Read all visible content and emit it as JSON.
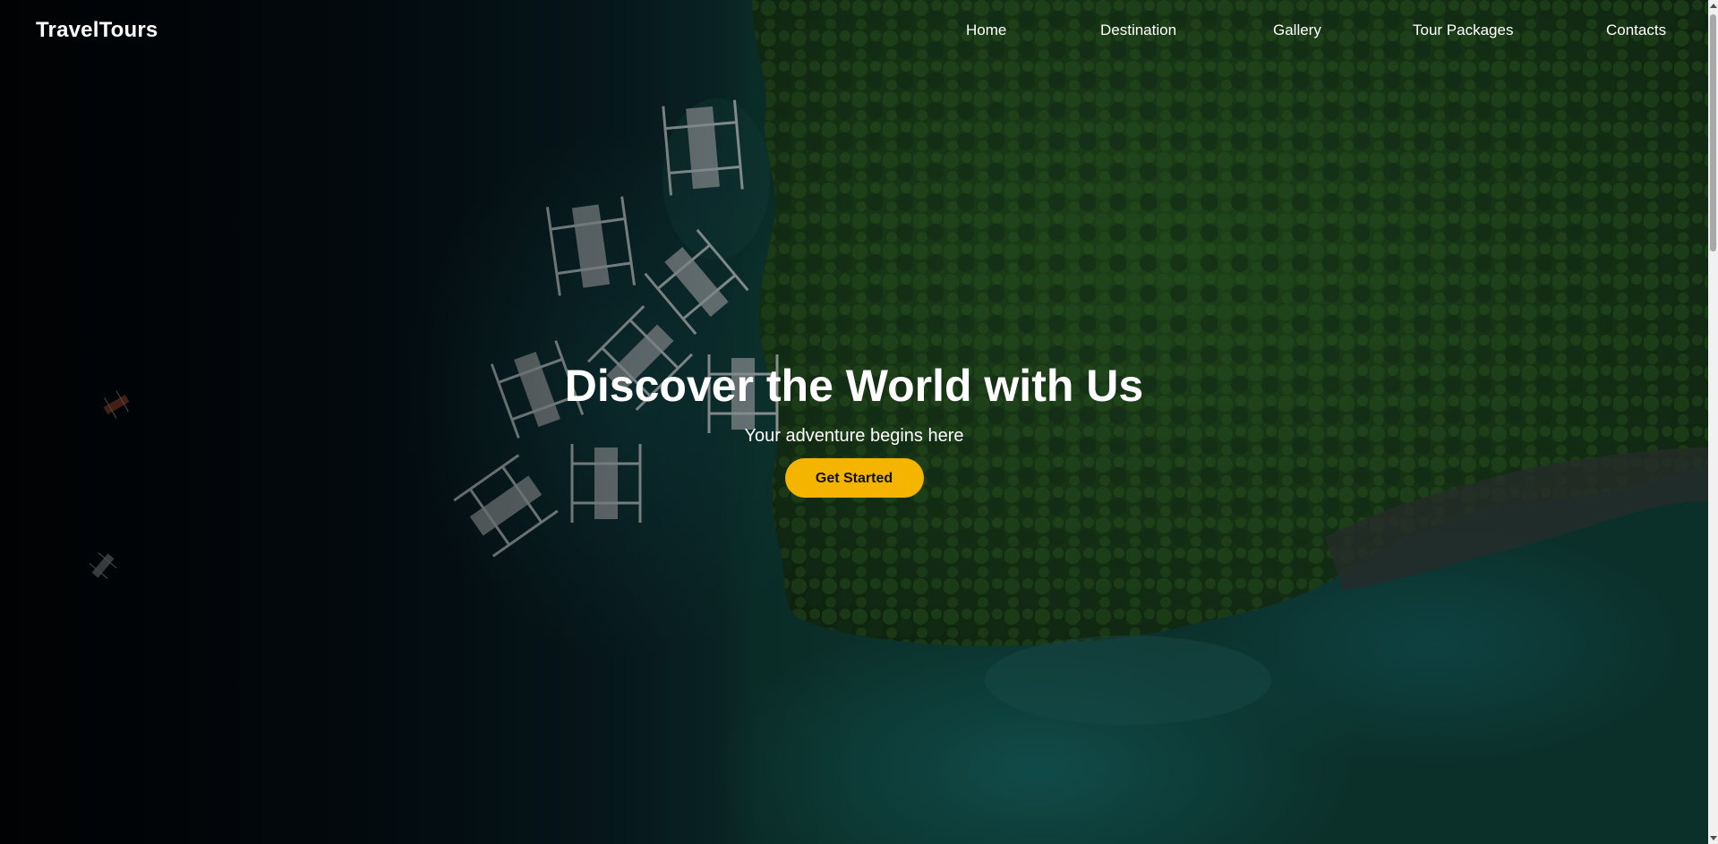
{
  "navbar": {
    "brand": "TravelTours",
    "links": [
      {
        "label": "Home"
      },
      {
        "label": "Destination"
      },
      {
        "label": "Gallery"
      },
      {
        "label": "Tour Packages"
      },
      {
        "label": "Contacts"
      }
    ]
  },
  "hero": {
    "title": "Discover the World with Us",
    "subtitle": "Your adventure begins here",
    "cta_label": "Get Started"
  },
  "colors": {
    "accent": "#f5b400",
    "text": "#ffffff"
  },
  "icons": {
    "scroll_up": "chevron-up-icon",
    "scroll_down": "chevron-down-icon"
  }
}
